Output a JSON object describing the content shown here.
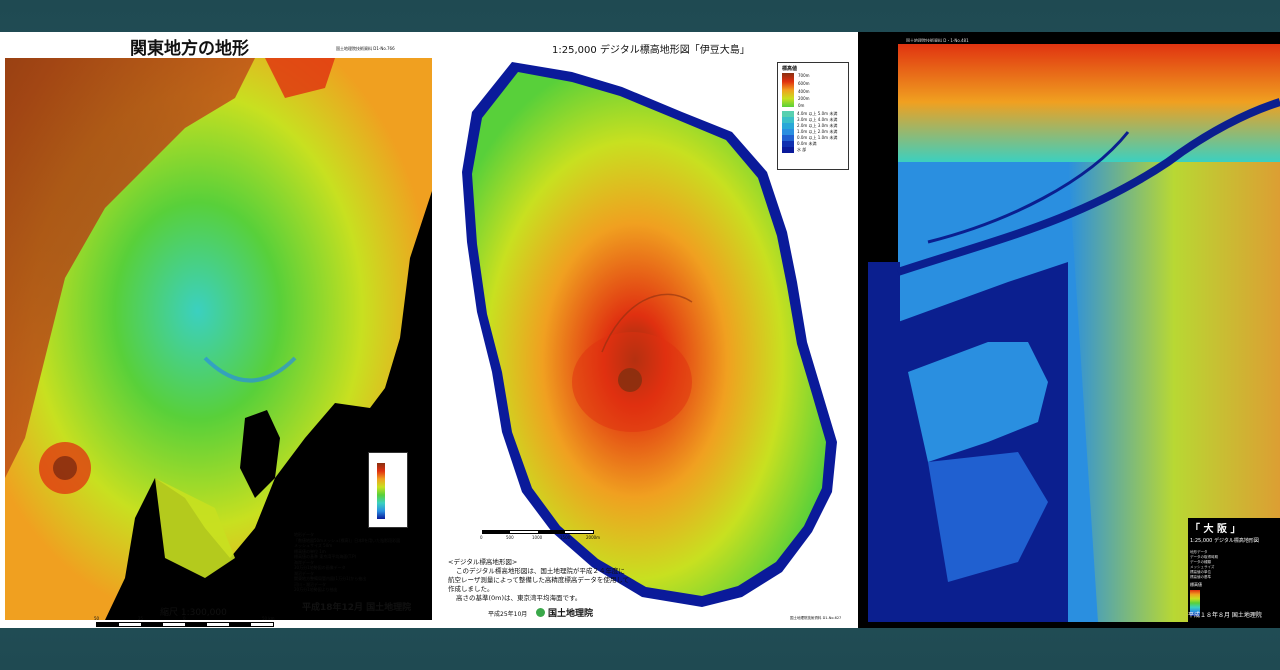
{
  "kanto": {
    "title": "関東地方の地形",
    "doc_id": "国土地理院技術資料 D1-No.766",
    "scale_text": "縮尺 1:300,000",
    "date_org": "平成18年12月 国土地理院",
    "notes": [
      "地形データ",
      "「数値地図50mメッシュ(標高)」日本Ⅱを用いた陰影段彩図",
      "メッシュサイズ 50m",
      "標高値の単位 1m",
      "標高値の基準 東京湾平均海面(T.P)",
      "海岸データ",
      "30万分1地勢図の画像データ",
      "湖沼データ",
      "関東地方整備局管内図(1万分1)から抽出",
      "河川・湖沼データ",
      "20万分1地勢図より抽出"
    ],
    "scale_ticks": [
      "50",
      "25",
      "0",
      "50 km"
    ]
  },
  "izu": {
    "title": "1:25,000 デジタル標高地形図「伊豆大島」",
    "legend_title": "標高値",
    "legend_items": [
      "700m",
      "600m",
      "400m",
      "200m",
      "0m",
      "4.0m 以上 5.0m 未満",
      "3.0m 以上 4.0m 未満",
      "2.0m 以上 3.0m 未満",
      "1.0m 以上 2.0m 未満",
      "0.0m 以上 1.0m 未満",
      "0.0m 未満",
      "水 部"
    ],
    "note_heading": "<デジタル標高地形図>",
    "note_lines": [
      "このデジタル標高地形図は、国土地理院が平成２４年度に",
      "航空レーザ測量によって整備した高精度標高データを使用して",
      "作成しました。",
      "高さの基準(0m)は、東京湾平均海面です。"
    ],
    "date": "平成25年10月",
    "org": "国土地理院",
    "doc_id": "国土地理院技術資料 D1-No.627",
    "scale_ticks": [
      "0",
      "500",
      "1000",
      "1500",
      "2000m"
    ]
  },
  "osaka": {
    "doc_id": "国土地理院技術資料 D・1-No.481",
    "title": "「 大 阪 」",
    "subtitle": "1:25,000 デジタル標高地形図",
    "date_org": "平成１８年８月 国土地理院",
    "legend_title": "標高値",
    "notes": [
      "地形データ",
      "データの取得時期",
      "データの種類",
      "メッシュサイズ",
      "標高値の単位",
      "標高値の基準"
    ]
  },
  "colors": {
    "background": "#275862",
    "sea_kanto": "#000000",
    "sea_izu": "#0a1a9a",
    "sea_osaka": "#0b1f8f",
    "ramp": [
      "#0a1a9a",
      "#2a8fe0",
      "#3bd0c0",
      "#58d03a",
      "#c8e020",
      "#f0a020",
      "#e03010",
      "#8a3010"
    ]
  }
}
